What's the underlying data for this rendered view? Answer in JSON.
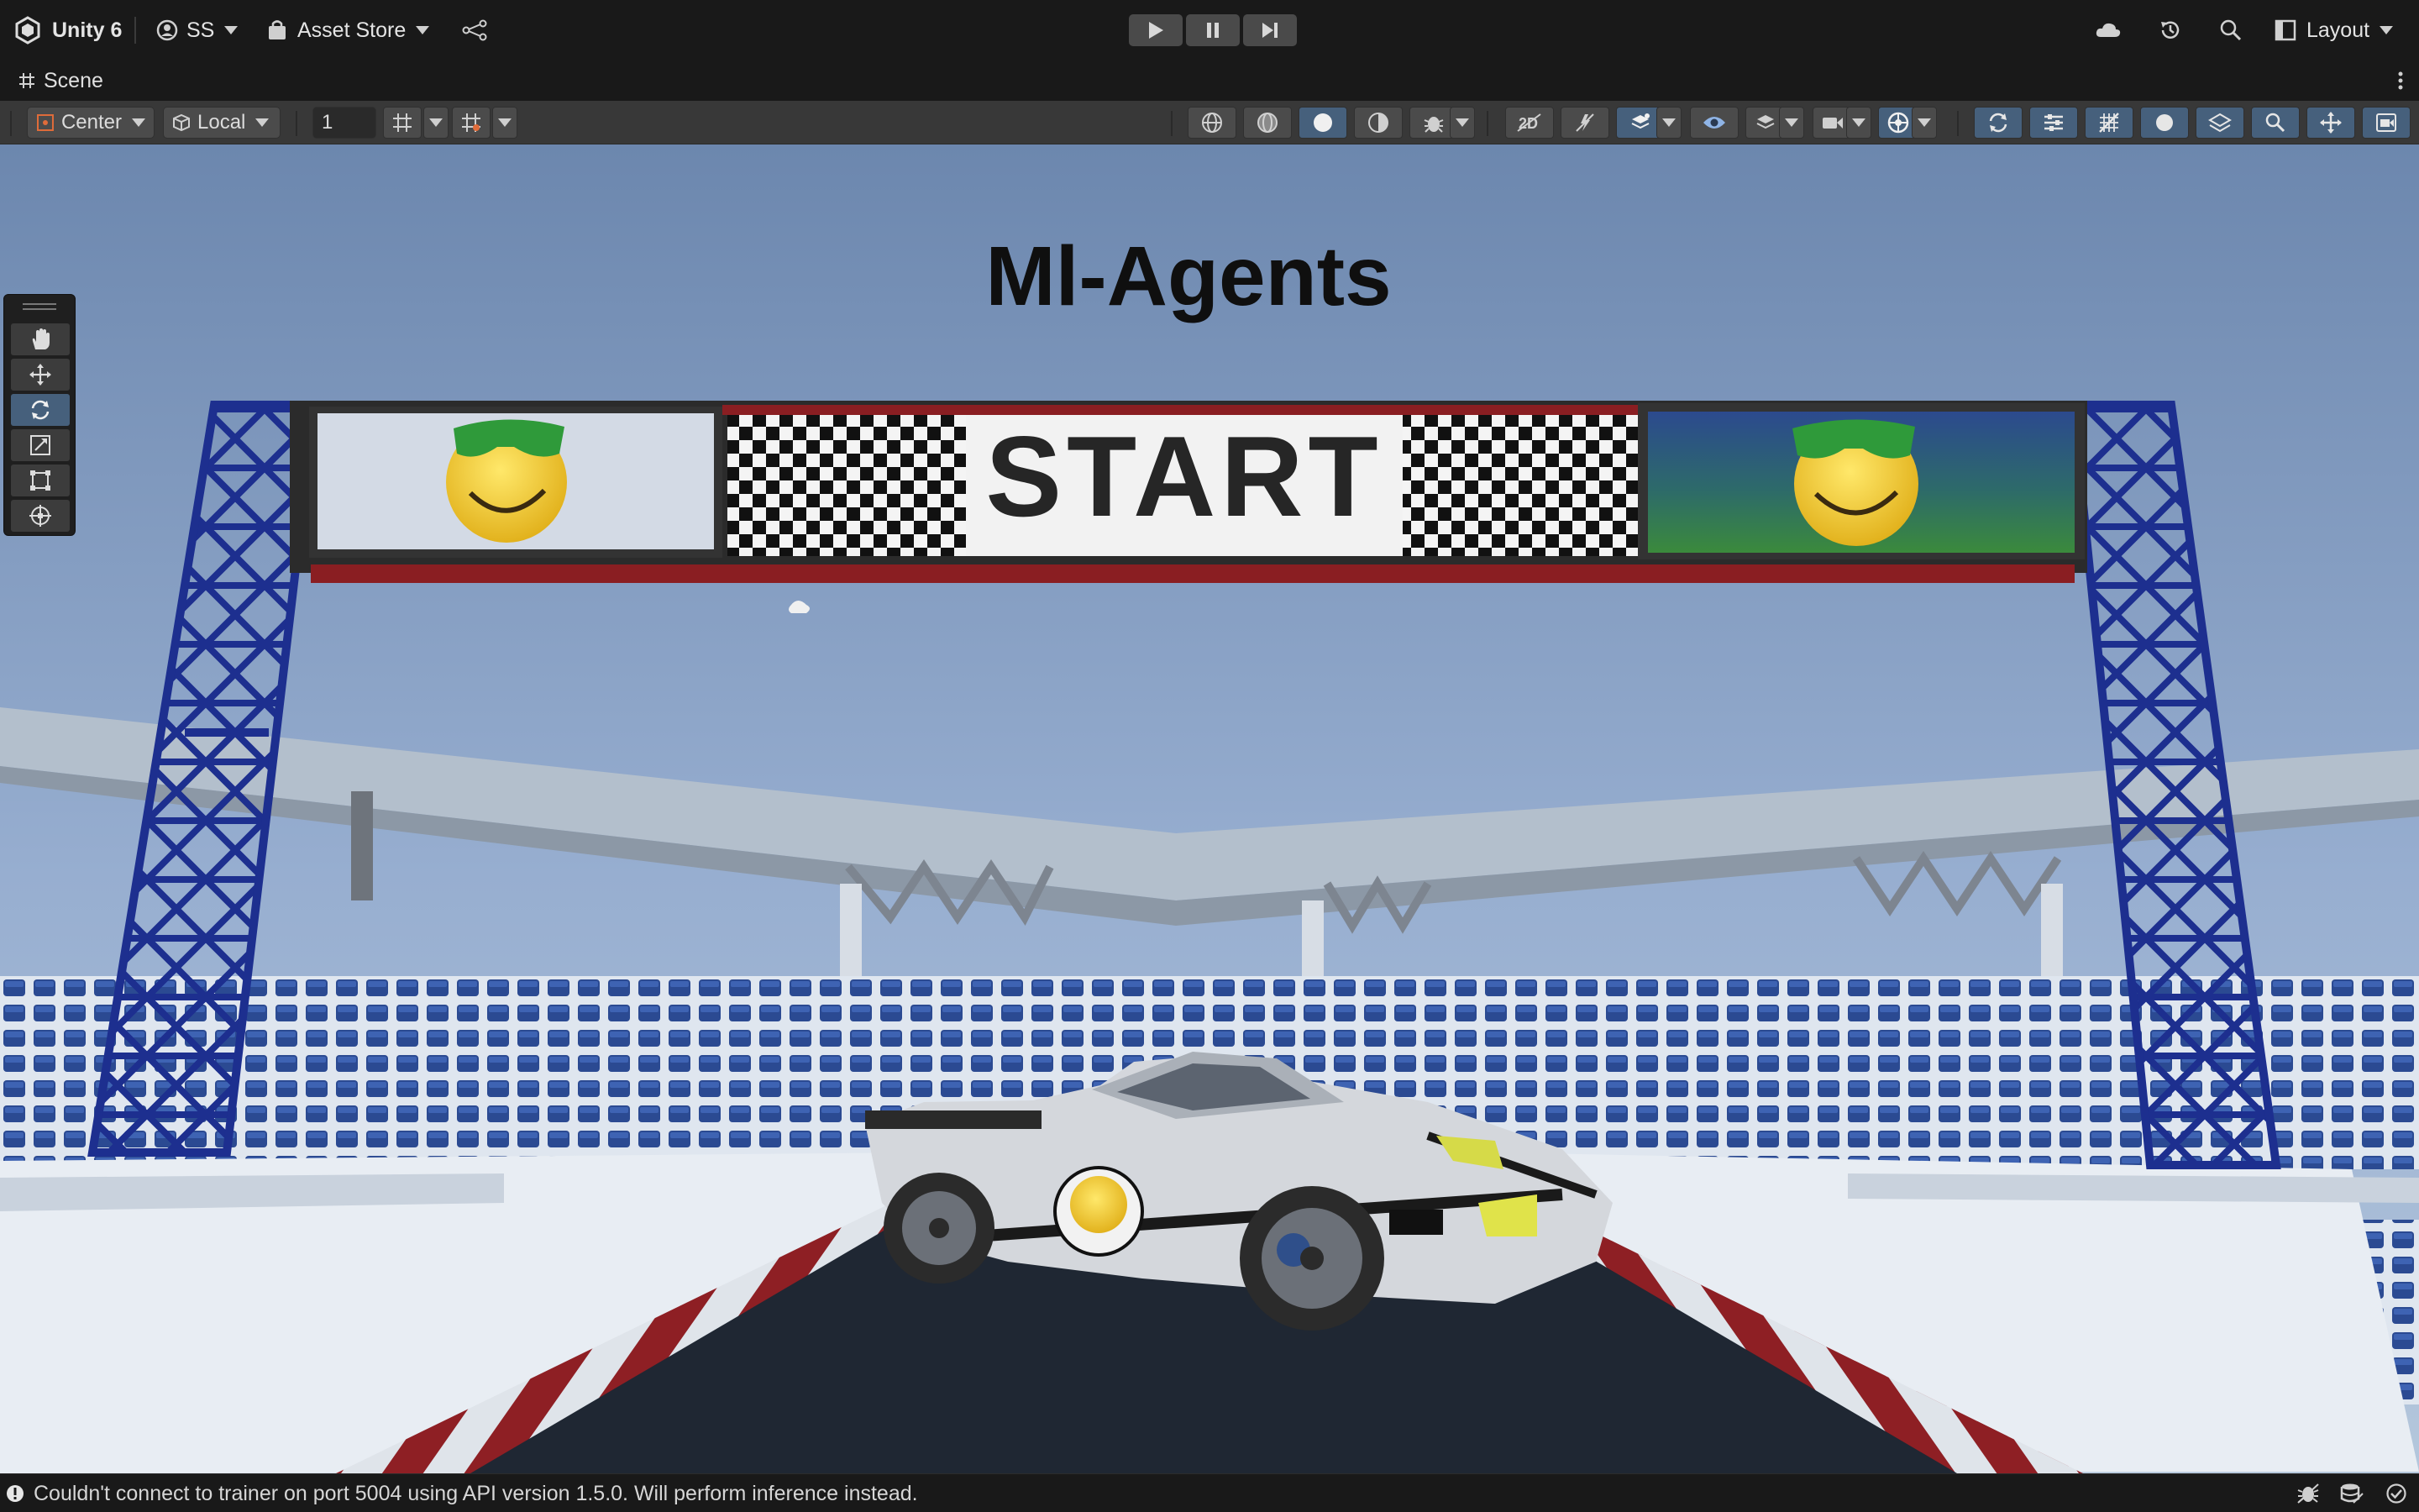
{
  "topbar": {
    "app_label": "Unity 6",
    "account_label": "SS",
    "store_label": "Asset Store",
    "layout_label": "Layout",
    "icons": [
      "unity-logo-icon",
      "account-icon",
      "store-bag-icon",
      "version-control-icon",
      "play-icon",
      "pause-icon",
      "step-icon",
      "cloud-icon",
      "history-icon",
      "search-icon",
      "layout-icon"
    ]
  },
  "scene_tab": {
    "label": "Scene"
  },
  "scene_toolbar": {
    "pivot_mode": "Center",
    "pivot_rotation": "Local",
    "grid_increment": "1"
  },
  "viewport": {
    "scene_text": "Ml-Agents",
    "banner_text": "START",
    "colors": {
      "sky_top": "#6f8ab0",
      "sky_bottom": "#aec3da",
      "truss": "#1d2f8f",
      "track": "#1f2733",
      "kerb_red": "#8e1f24",
      "seat_blue": "#2b4a92"
    }
  },
  "tools_palette": {
    "tools": [
      "hand-tool-icon",
      "move-tool-icon",
      "rotate-tool-icon",
      "scale-tool-icon",
      "rect-tool-icon",
      "transform-tool-icon"
    ],
    "active_tool": "rotate-tool-icon"
  },
  "statusbar": {
    "message": "Couldn't connect to trainer on port 5004 using API version 1.5.0. Will perform inference instead."
  }
}
